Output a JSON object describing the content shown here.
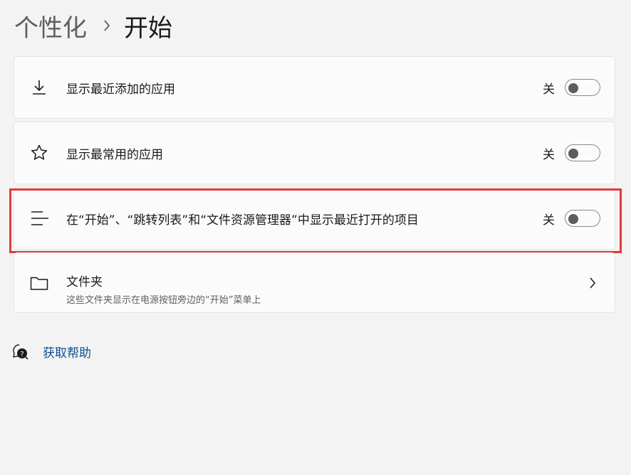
{
  "breadcrumb": {
    "parent": "个性化",
    "current": "开始"
  },
  "settings": [
    {
      "label": "显示最近添加的应用",
      "state": "关"
    },
    {
      "label": "显示最常用的应用",
      "state": "关"
    },
    {
      "label": "在“开始”、“跳转列表”和“文件资源管理器”中显示最近打开的项目",
      "state": "关"
    }
  ],
  "folders": {
    "title": "文件夹",
    "subtitle": "这些文件夹显示在电源按钮旁边的“开始”菜单上"
  },
  "help": {
    "label": "获取帮助"
  }
}
